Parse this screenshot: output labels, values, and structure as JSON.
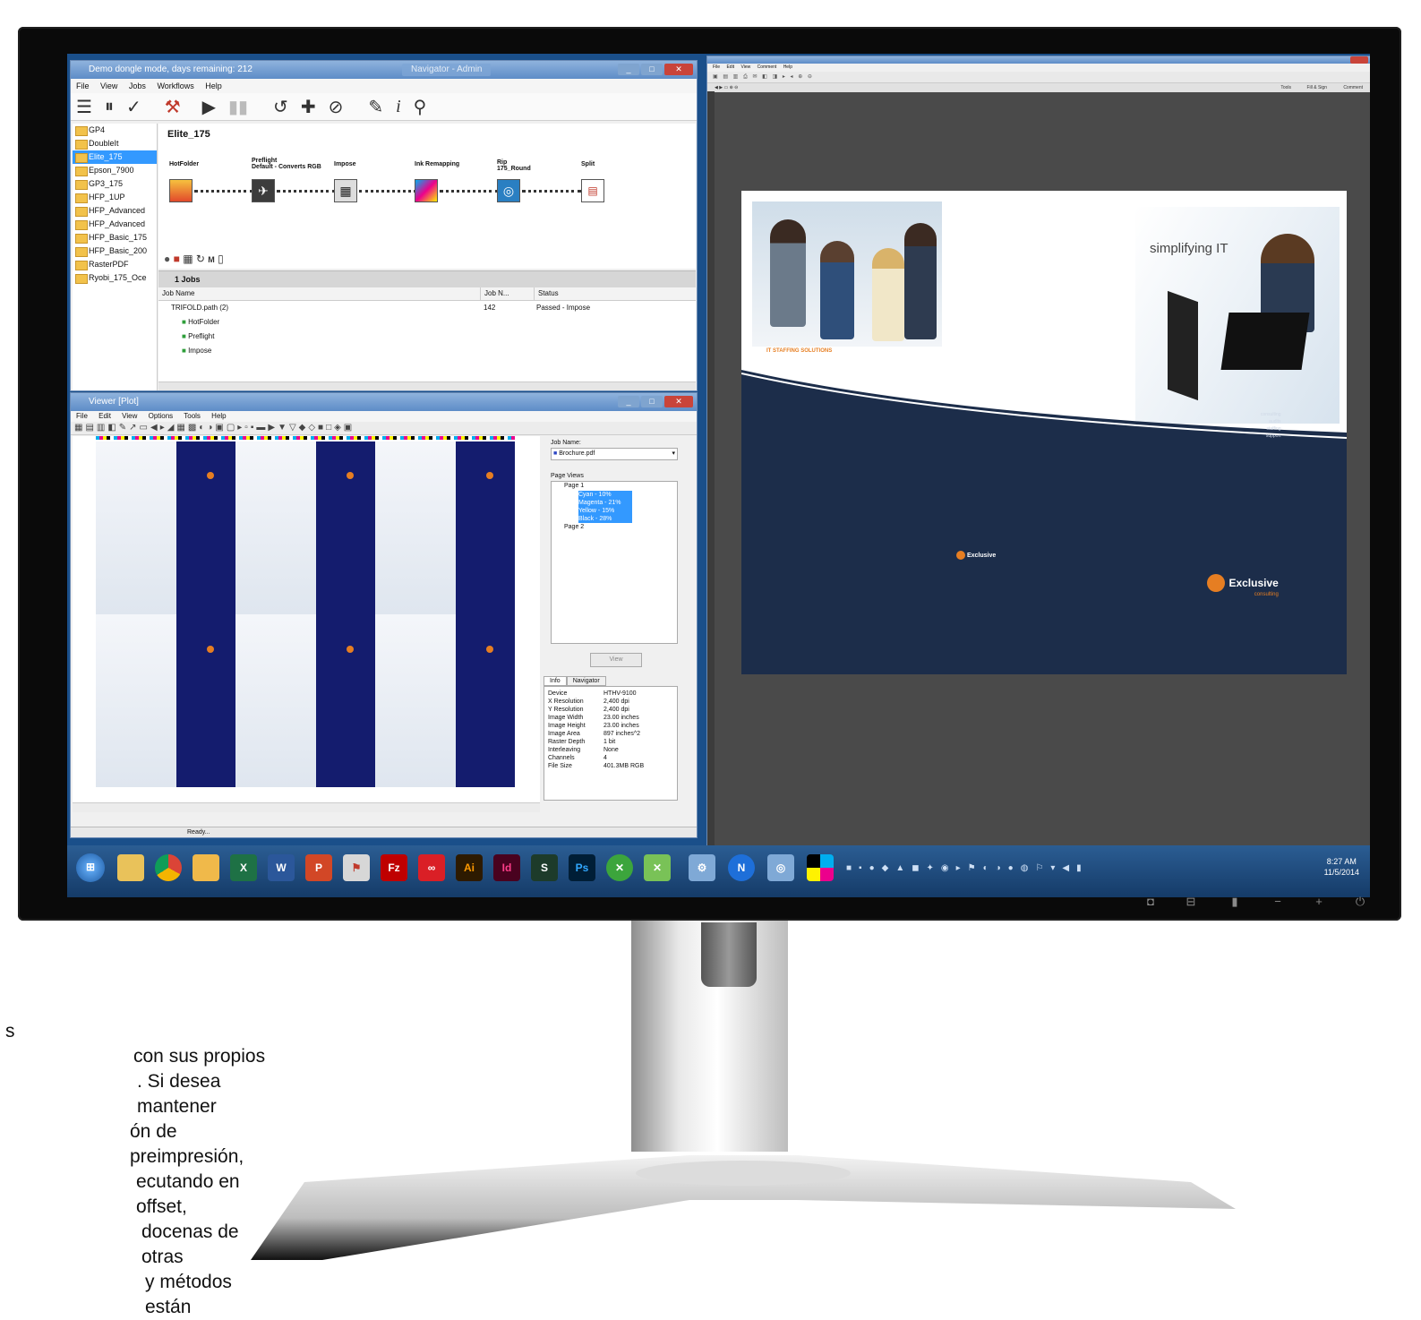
{
  "workflow_window": {
    "title": "Demo dongle mode, days remaining: 212",
    "tab_label": "Navigator - Admin",
    "menu": [
      "File",
      "View",
      "Jobs",
      "Workflows",
      "Help"
    ],
    "workflows": [
      "GP4",
      "DoubleIt",
      "Elite_175",
      "Epson_7900",
      "GP3_175",
      "HFP_1UP",
      "HFP_Advanced",
      "HFP_Advanced",
      "HFP_Basic_175",
      "HFP_Basic_200",
      "RasterPDF",
      "Ryobi_175_Oce"
    ],
    "selected_workflow_index": 2,
    "workflow_title": "Elite_175",
    "nodes": [
      {
        "label": "HotFolder",
        "icon": "hotfolder-icon"
      },
      {
        "label": "Preflight\nDefault - Converts RGB",
        "icon": "preflight-icon"
      },
      {
        "label": "Impose",
        "icon": "impose-icon"
      },
      {
        "label": "Ink Remapping",
        "icon": "ink-remapping-icon"
      },
      {
        "label": "Rip\n175_Round",
        "icon": "rip-icon"
      },
      {
        "label": "Split",
        "icon": "split-icon"
      }
    ],
    "jobs_count": "1 Jobs",
    "jobs_columns": [
      "Job Name",
      "Job N...",
      "Status"
    ],
    "jobs": [
      {
        "name": "TRIFOLD.path (2)",
        "number": "142",
        "status": "Passed - Impose"
      },
      {
        "name": "HotFolder",
        "number": "",
        "status": ""
      },
      {
        "name": "Preflight",
        "number": "",
        "status": ""
      },
      {
        "name": "Impose",
        "number": "",
        "status": ""
      }
    ]
  },
  "viewer_window": {
    "title": "Viewer [Plot]",
    "menu": [
      "File",
      "Edit",
      "View",
      "Options",
      "Tools",
      "Help"
    ],
    "job_name_label": "Job Name:",
    "job_name_value": "Brochure.pdf",
    "page_views_label": "Page Views",
    "page_tree": [
      {
        "label": "Page 1",
        "level": 0
      },
      {
        "label": "Cyan - 10%",
        "level": 1
      },
      {
        "label": "Magenta - 21%",
        "level": 1
      },
      {
        "label": "Yellow - 15%",
        "level": 1
      },
      {
        "label": "Black - 28%",
        "level": 1
      },
      {
        "label": "Page 2",
        "level": 0
      }
    ],
    "view_button": "View",
    "info_tabs": [
      "Info",
      "Navigator"
    ],
    "info_rows": [
      {
        "k": "Device",
        "v": "HTHV-9100"
      },
      {
        "k": "X Resolution",
        "v": "2,400 dpi"
      },
      {
        "k": "Y Resolution",
        "v": "2,400 dpi"
      },
      {
        "k": "Image Width",
        "v": "23.00 inches"
      },
      {
        "k": "Image Height",
        "v": "23.00 inches"
      },
      {
        "k": "Image Area",
        "v": "897 inches^2"
      },
      {
        "k": "Raster Depth",
        "v": "1 bit"
      },
      {
        "k": "Interleaving",
        "v": "None"
      },
      {
        "k": "Channels",
        "v": "4"
      },
      {
        "k": "File Size",
        "v": "401.3MB RGB"
      }
    ],
    "status": "Ready..."
  },
  "pdf_window": {
    "menu": [
      "File",
      "Edit",
      "View",
      "Comment",
      "Help"
    ],
    "toolbar_right": [
      "Tools",
      "Fill & Sign",
      "Comment"
    ],
    "brochure": {
      "headline": "simplifying IT",
      "section_title": "IT STAFFING SOLUTIONS",
      "brand": "Exclusive",
      "brand_sub": "consulting",
      "right_list": [
        "consulting",
        "audits",
        "staffing",
        "support"
      ]
    }
  },
  "taskbar": {
    "apps": [
      "Start",
      "Explorer",
      "Chrome",
      "Folder",
      "Excel",
      "Word",
      "PowerPoint",
      "Acrobat",
      "FileZilla",
      "Creative Cloud",
      "Ai",
      "Id",
      "S",
      "Ps",
      "X",
      "X",
      "Settings",
      "N",
      "Browser",
      "Color"
    ],
    "time": "8:27 AM",
    "date": "11/5/2014"
  },
  "side_text": [
    "s",
    "con sus propios",
    ". Si desea mantener",
    "ón de preimpresión,",
    "ecutando en offset,",
    "docenas de otras",
    "y métodos están"
  ]
}
